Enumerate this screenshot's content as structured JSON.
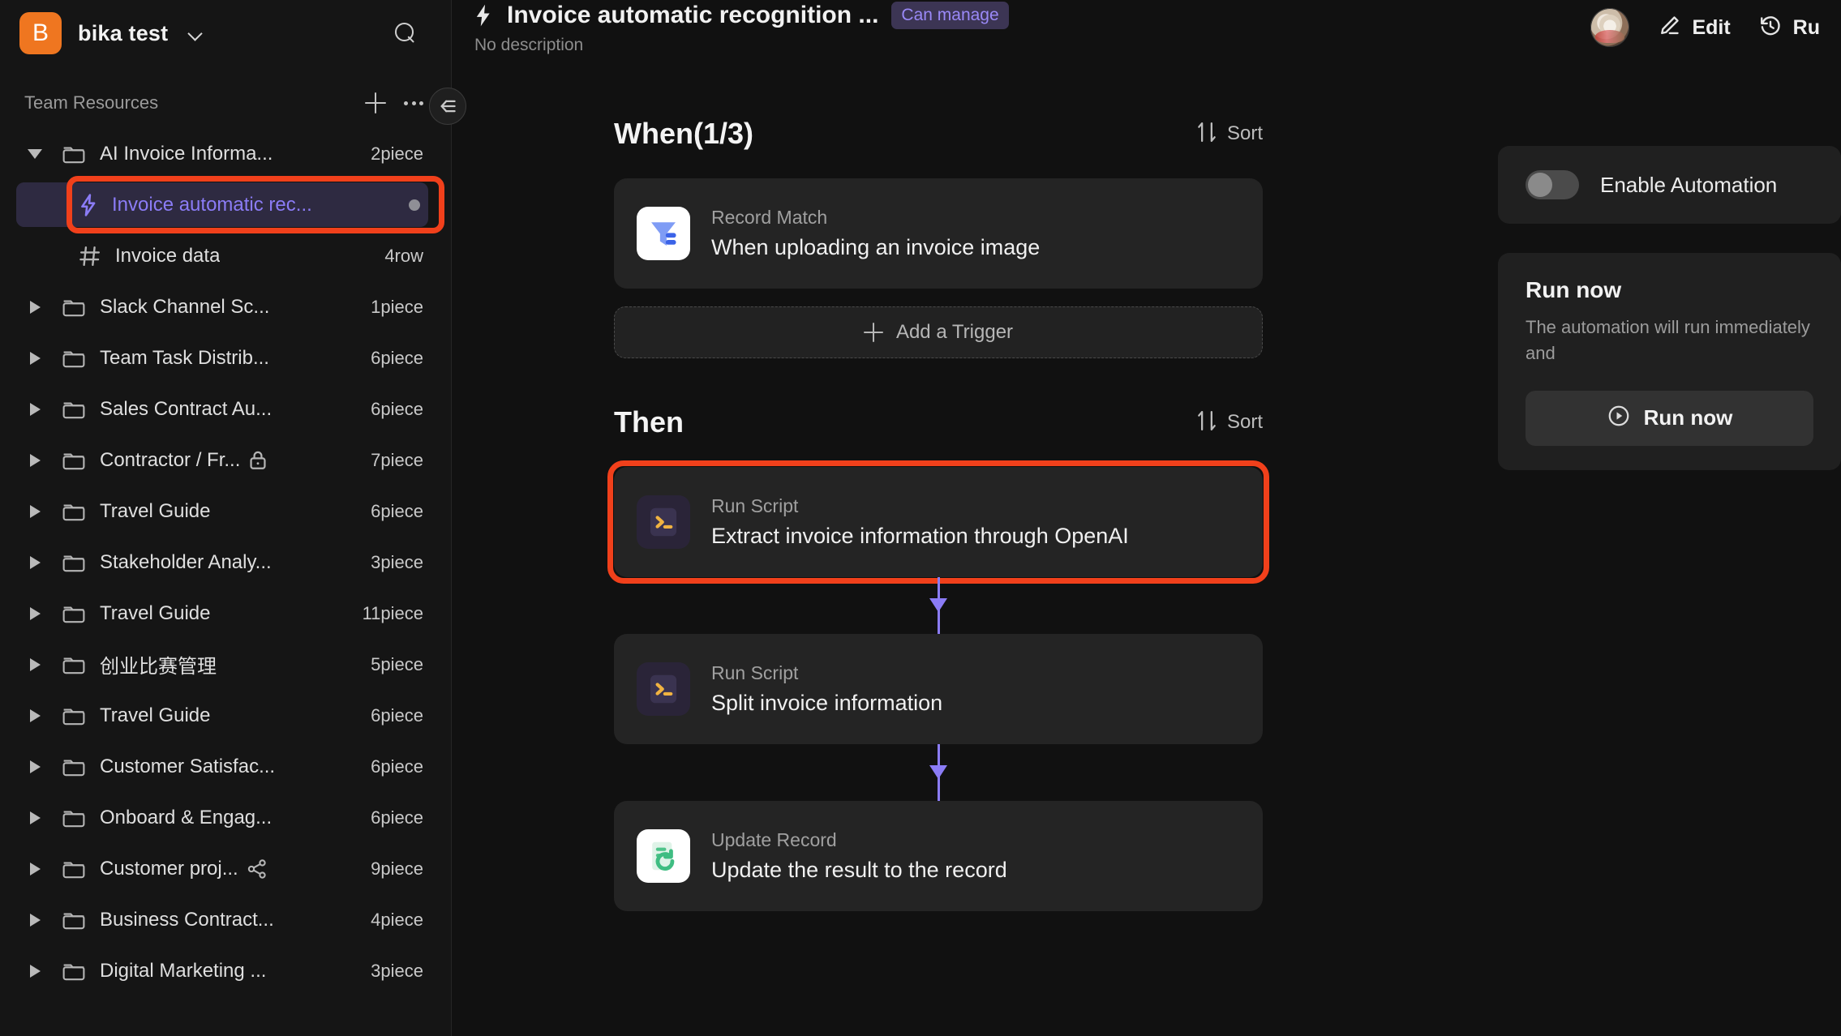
{
  "sidebar": {
    "workspace": {
      "initial": "B",
      "name": "bika test"
    },
    "section": {
      "title": "Team Resources"
    },
    "items": [
      {
        "label": "AI Invoice Informa...",
        "count": "2piece",
        "expanded": true,
        "type": "folder"
      },
      {
        "label": "Invoice automatic rec...",
        "count": "",
        "type": "automation",
        "selected": true,
        "child": true
      },
      {
        "label": "Invoice data",
        "count": "4row",
        "type": "table",
        "child": true
      },
      {
        "label": "Slack Channel Sc...",
        "count": "1piece",
        "expanded": false,
        "type": "folder"
      },
      {
        "label": "Team Task Distrib...",
        "count": "6piece",
        "expanded": false,
        "type": "folder"
      },
      {
        "label": "Sales Contract Au...",
        "count": "6piece",
        "expanded": false,
        "type": "folder"
      },
      {
        "label": "Contractor / Fr...",
        "count": "7piece",
        "expanded": false,
        "type": "folder",
        "lock": true
      },
      {
        "label": "Travel Guide",
        "count": "6piece",
        "expanded": false,
        "type": "folder"
      },
      {
        "label": "Stakeholder Analy...",
        "count": "3piece",
        "expanded": false,
        "type": "folder"
      },
      {
        "label": "Travel Guide",
        "count": "11piece",
        "expanded": false,
        "type": "folder"
      },
      {
        "label": "创业比赛管理",
        "count": "5piece",
        "expanded": false,
        "type": "folder"
      },
      {
        "label": "Travel Guide",
        "count": "6piece",
        "expanded": false,
        "type": "folder"
      },
      {
        "label": "Customer Satisfac...",
        "count": "6piece",
        "expanded": false,
        "type": "folder"
      },
      {
        "label": "Onboard & Engag...",
        "count": "6piece",
        "expanded": false,
        "type": "folder"
      },
      {
        "label": "Customer proj...",
        "count": "9piece",
        "expanded": false,
        "type": "folder",
        "share": true
      },
      {
        "label": "Business Contract...",
        "count": "4piece",
        "expanded": false,
        "type": "folder"
      },
      {
        "label": "Digital Marketing ...",
        "count": "3piece",
        "expanded": false,
        "type": "folder"
      }
    ]
  },
  "header": {
    "title": "Invoice automatic recognition ...",
    "permission_badge": "Can manage",
    "subtitle": "No description",
    "edit_label": "Edit",
    "run_label": "Ru"
  },
  "flow": {
    "when": {
      "title": "When(1/3)",
      "sort_label": "Sort",
      "cards": [
        {
          "kind": "Record Match",
          "name": "When uploading an invoice image",
          "icon": "filter-icon"
        }
      ],
      "add_trigger_label": "Add a Trigger"
    },
    "then": {
      "title": "Then",
      "sort_label": "Sort",
      "cards": [
        {
          "kind": "Run Script",
          "name": "Extract invoice information through OpenAI",
          "icon": "terminal-icon",
          "highlighted": true
        },
        {
          "kind": "Run Script",
          "name": "Split invoice information",
          "icon": "terminal-icon",
          "highlighted": false
        },
        {
          "kind": "Update Record",
          "name": "Update the result to the record",
          "icon": "update-record-icon",
          "highlighted": false
        }
      ]
    }
  },
  "right_panel": {
    "enable_automation_label": "Enable Automation",
    "enable_automation_on": false,
    "run_now_title": "Run now",
    "run_now_desc": "The automation will run immediately and",
    "run_now_button": "Run now"
  },
  "colors": {
    "accent_purple": "#8b7cf6",
    "highlight_red": "#f1401b",
    "logo_orange": "#ef7620",
    "card_bg": "#242424",
    "page_bg": "#111111"
  }
}
